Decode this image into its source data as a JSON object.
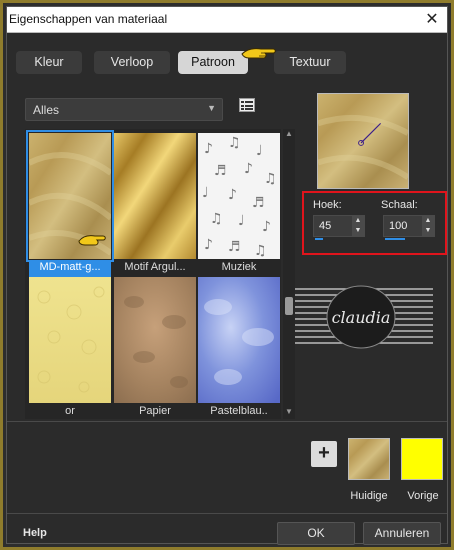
{
  "window": {
    "title": "Eigenschappen van materiaal",
    "close_icon": "close-icon"
  },
  "tabs": [
    {
      "label": "Kleur",
      "active": false
    },
    {
      "label": "Verloop",
      "active": false
    },
    {
      "label": "Patroon",
      "active": true
    },
    {
      "label": "Textuur",
      "active": false
    }
  ],
  "category_select": {
    "value": "Alles"
  },
  "patterns": [
    {
      "label": "MD-matt-g...",
      "selected": true
    },
    {
      "label": "Motif Argul...",
      "selected": false
    },
    {
      "label": "Muziek",
      "selected": false
    },
    {
      "label": "or",
      "selected": false
    },
    {
      "label": "Papier",
      "selected": false
    },
    {
      "label": "Pastelblau..",
      "selected": false
    }
  ],
  "params": {
    "angle_label": "Hoek:",
    "angle_value": "45",
    "scale_label": "Schaal:",
    "scale_value": "100"
  },
  "watermark": {
    "text": "claudia"
  },
  "current_label": "Huidige",
  "previous_label": "Vorige",
  "colors": {
    "previous_swatch": "#ffff00",
    "highlight": "#e0141c",
    "accent": "#2f8ee6"
  },
  "footer": {
    "help": "Help",
    "ok": "OK",
    "cancel": "Annuleren"
  }
}
